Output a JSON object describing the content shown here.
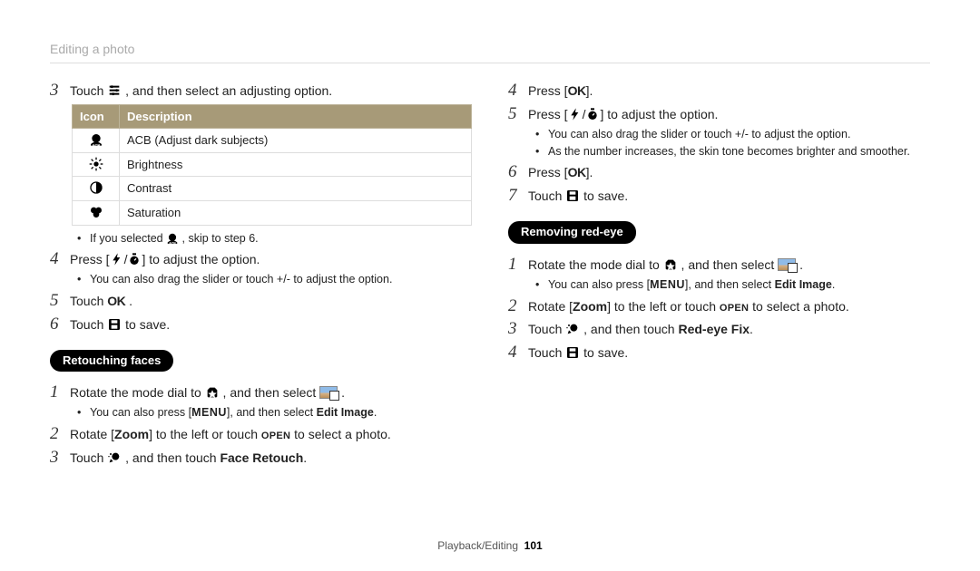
{
  "topic": "Editing a photo",
  "footer": {
    "section": "Playback/Editing",
    "page": "101"
  },
  "table": {
    "head_icon": "Icon",
    "head_desc": "Description",
    "rows": [
      {
        "icon": "acb",
        "desc": "ACB (Adjust dark subjects)"
      },
      {
        "icon": "brightness",
        "desc": "Brightness"
      },
      {
        "icon": "contrast",
        "desc": "Contrast"
      },
      {
        "icon": "saturation",
        "desc": "Saturation"
      }
    ]
  },
  "left": {
    "s3_a": "Touch ",
    "s3_b": " , and then select an adjusting option.",
    "sub_skip_a": "If you selected ",
    "sub_skip_b": " , skip to step 6.",
    "s4_a": "Press [",
    "s4_b": "/",
    "s4_c": "] to adjust the option.",
    "sub_drag": "You can also drag the slider or touch +/- to adjust the option.",
    "s5_a": "Touch ",
    "s5_ok": "OK",
    "s5_c": " .",
    "s6_a": "Touch ",
    "s6_b": " to save.",
    "h_retouch": "Retouching faces",
    "r1_a": "Rotate the mode dial to ",
    "r1_b": " , and then select ",
    "r1_c": " .",
    "r_sub_a": "You can also press [",
    "r_sub_menu": "MENU",
    "r_sub_b": "], and then select ",
    "r_sub_bold": "Edit Image",
    "r_sub_c": ".",
    "r2_a": "Rotate [",
    "r2_zoom": "Zoom",
    "r2_b": "] to the left or touch ",
    "r2_open": "OPEN",
    "r2_c": " to select a photo.",
    "r3_a": "Touch ",
    "r3_b": " , and then touch ",
    "r3_bold": "Face Retouch",
    "r3_c": "."
  },
  "right": {
    "s4_a": "Press [",
    "s4_ok": "OK",
    "s4_b": "].",
    "s5_a": "Press [",
    "s5_b": "/",
    "s5_c": "] to adjust the option.",
    "sub_drag": "You can also drag the slider or touch +/- to adjust the option.",
    "sub_skin": "As the number increases, the skin tone becomes brighter and smoother.",
    "s6_a": "Press [",
    "s6_ok": "OK",
    "s6_b": "].",
    "s7_a": "Touch ",
    "s7_b": " to save.",
    "h_redeye": "Removing red-eye",
    "e1_a": "Rotate the mode dial to ",
    "e1_b": " , and then select ",
    "e1_c": " .",
    "e_sub_a": "You can also press [",
    "e_sub_menu": "MENU",
    "e_sub_b": "], and then select ",
    "e_sub_bold": "Edit Image",
    "e_sub_c": ".",
    "e2_a": "Rotate [",
    "e2_zoom": "Zoom",
    "e2_b": "] to the left or touch ",
    "e2_open": "OPEN",
    "e2_c": " to select a photo.",
    "e3_a": "Touch ",
    "e3_b": " , and then touch ",
    "e3_bold": "Red-eye Fix",
    "e3_c": ".",
    "e4_a": "Touch ",
    "e4_b": " to save."
  },
  "nums": {
    "n1": "1",
    "n2": "2",
    "n3": "3",
    "n4": "4",
    "n5": "5",
    "n6": "6",
    "n7": "7"
  }
}
